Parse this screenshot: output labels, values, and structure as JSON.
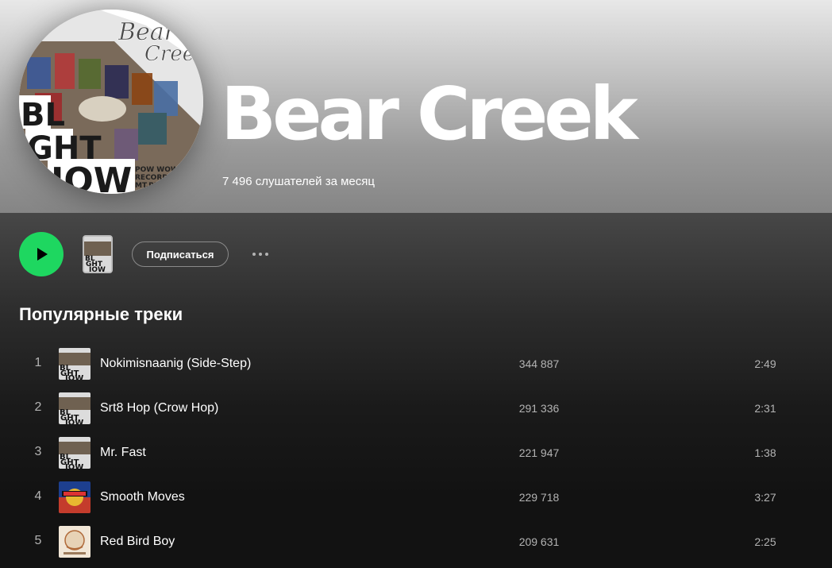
{
  "artist": {
    "name": "Bear Creek",
    "monthly_listeners": "7 496 слушателей за месяц",
    "avatar_text": [
      "Bear",
      "Creek",
      "POW WOW S",
      "RECORDED",
      "MT.PLEA"
    ]
  },
  "controls": {
    "follow_label": "Подписаться"
  },
  "popular": {
    "title": "Популярные треки",
    "tracks": [
      {
        "num": "1",
        "title": "Nokimisnaanig (Side-Step)",
        "plays": "344 887",
        "duration": "2:49",
        "cover": "bw"
      },
      {
        "num": "2",
        "title": "Srt8 Hop (Crow Hop)",
        "plays": "291 336",
        "duration": "2:31",
        "cover": "bw"
      },
      {
        "num": "3",
        "title": "Mr. Fast",
        "plays": "221 947",
        "duration": "1:38",
        "cover": "bw"
      },
      {
        "num": "4",
        "title": "Smooth Moves",
        "plays": "229 718",
        "duration": "3:27",
        "cover": "color"
      },
      {
        "num": "5",
        "title": "Red Bird Boy",
        "plays": "209 631",
        "duration": "2:25",
        "cover": "beige"
      }
    ]
  },
  "colors": {
    "accent": "#1ed760",
    "background": "#121212",
    "muted_text": "#b3b3b3"
  }
}
